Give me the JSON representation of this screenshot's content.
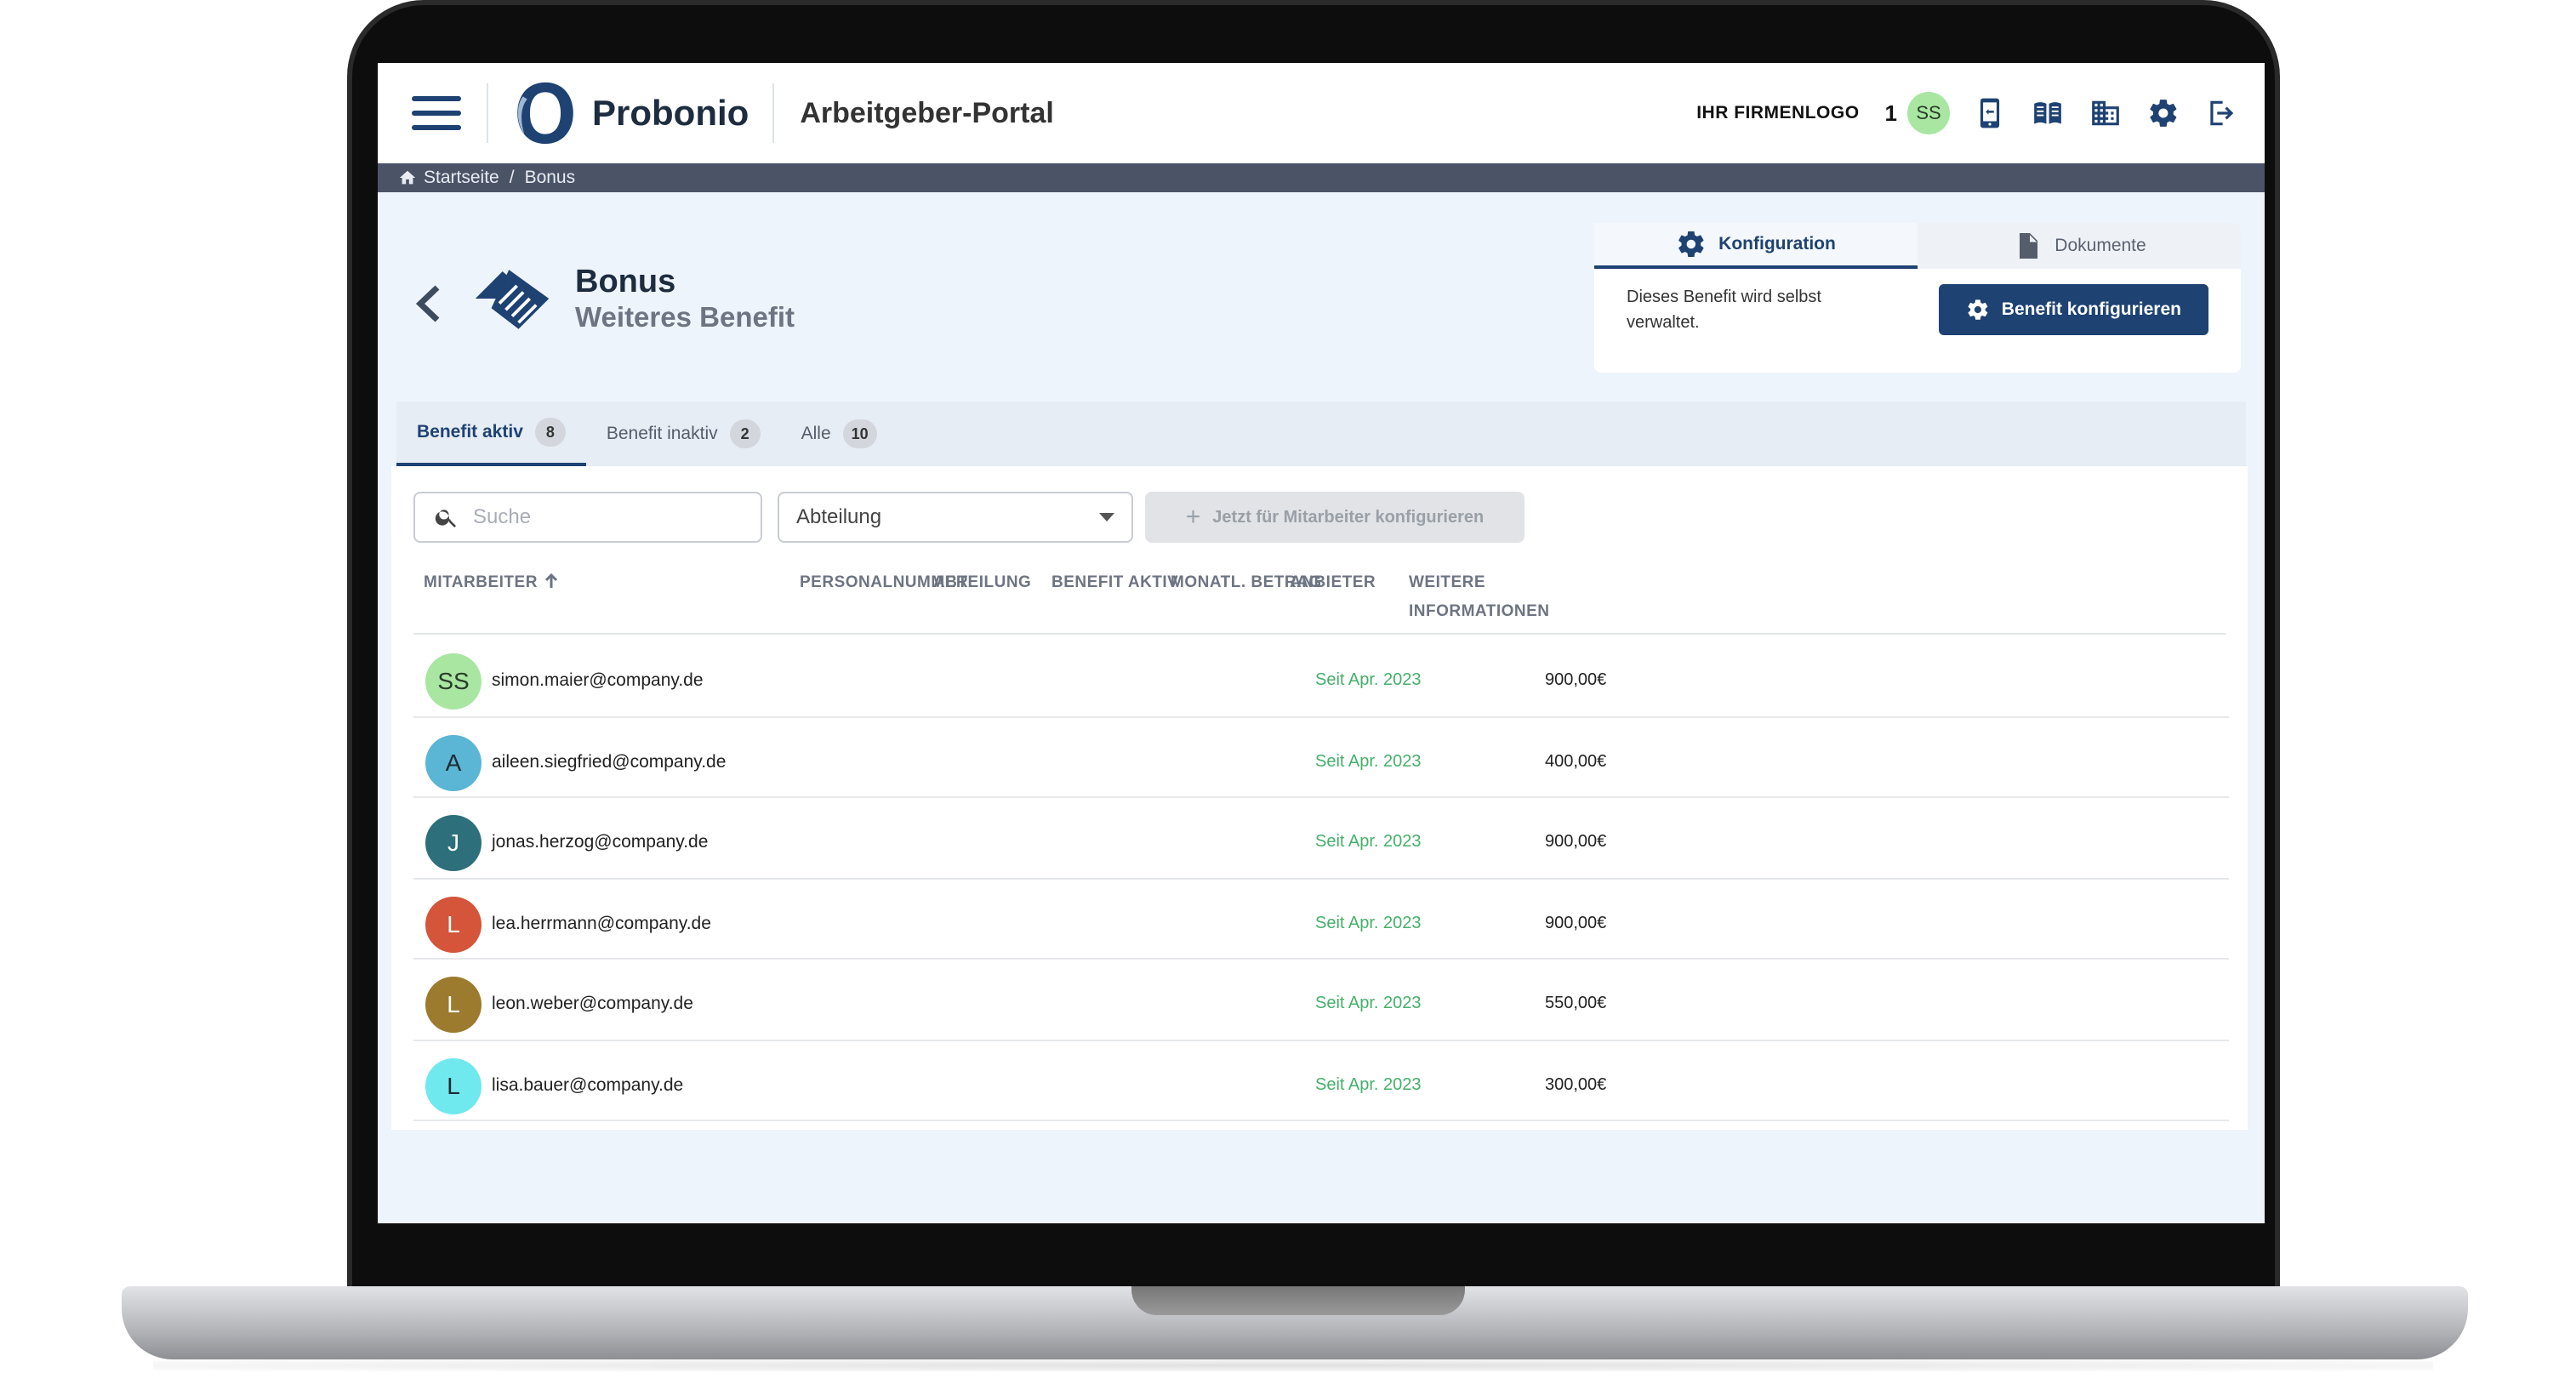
{
  "app": {
    "brand": "Probonio",
    "portal_title": "Arbeitgeber-Portal",
    "firm_logo_text": "IHR FIRMENLOGO",
    "notification_count": "1",
    "user_initials": "SS"
  },
  "breadcrumb": {
    "home": "Startseite",
    "separator": "/",
    "current": "Bonus"
  },
  "page": {
    "title": "Bonus",
    "subtitle": "Weiteres Benefit"
  },
  "config_card": {
    "tab_config": "Konfiguration",
    "tab_documents": "Dokumente",
    "text": "Dieses Benefit wird selbst verwaltet.",
    "button": "Benefit konfigurieren"
  },
  "tabs": [
    {
      "label": "Benefit aktiv",
      "count": "8"
    },
    {
      "label": "Benefit inaktiv",
      "count": "2"
    },
    {
      "label": "Alle",
      "count": "10"
    }
  ],
  "filters": {
    "search_placeholder": "Suche",
    "department": "Abteilung",
    "configure_button": "Jetzt für Mitarbeiter konfigurieren"
  },
  "table": {
    "columns": [
      "MITARBEITER",
      "PERSONALNUMMER",
      "ABTEILUNG",
      "BENEFIT AKTIV",
      "MONATL. BETRAG",
      "ANBIETER",
      "WEITERE INFORMATIONEN"
    ],
    "rows": [
      {
        "initials": "SS",
        "color": "#a8e6a1",
        "text_color": "#2a3b2a",
        "email": "simon.maier@company.de",
        "since": "Seit Apr. 2023",
        "amount": "900,00€"
      },
      {
        "initials": "A",
        "color": "#5bb5d5",
        "text_color": "#1c2b33",
        "email": "aileen.siegfried@company.de",
        "since": "Seit Apr. 2023",
        "amount": "400,00€"
      },
      {
        "initials": "J",
        "color": "#2d6f7a",
        "text_color": "#ffffff",
        "email": "jonas.herzog@company.de",
        "since": "Seit Apr. 2023",
        "amount": "900,00€"
      },
      {
        "initials": "L",
        "color": "#d4553a",
        "text_color": "#ffffff",
        "email": "lea.herrmann@company.de",
        "since": "Seit Apr. 2023",
        "amount": "900,00€"
      },
      {
        "initials": "L",
        "color": "#9c7a2e",
        "text_color": "#ffffff",
        "email": "leon.weber@company.de",
        "since": "Seit Apr. 2023",
        "amount": "550,00€"
      },
      {
        "initials": "L",
        "color": "#6fe8ee",
        "text_color": "#1c2b33",
        "email": "lisa.bauer@company.de",
        "since": "Seit Apr. 2023",
        "amount": "300,00€"
      }
    ]
  }
}
